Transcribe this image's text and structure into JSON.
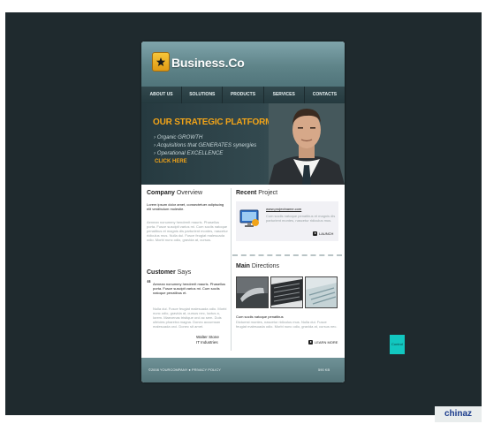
{
  "site": {
    "logo_text": "Business.Co",
    "nav": [
      "ABOUT US",
      "SOLUTIONS",
      "PRODUCTS",
      "SERVICES",
      "CONTACTS"
    ],
    "hero": {
      "title": "OUR STRATEGIC PLATFORM",
      "bullets": [
        "› Organic GROWTH",
        "› Acquisitions that GENERATES synergies",
        "› Operational EXCELLENCE"
      ],
      "cta": "CLICK HERE"
    },
    "company": {
      "title_bold": "Company",
      "title_light": "Overview",
      "intro": "Lorem ipsum dolor amet, consectetuer adipiscing elit vestibulum molestie.",
      "body": "Aenean nonummy hendrerit mauris. Phasellus porta. Fusce suscipit varius mi. Cum sociis natoque penatibus et magnis dis parturient montes, nascetur ridiculus mus. Nulla dui. Fusce feugiat malesuada odio. Morbi nunc odio, gravida at, cursus."
    },
    "customer": {
      "title_bold": "Customer",
      "title_light": "Says",
      "quote_mark": "“",
      "quote": "Aenean nonummy hendrerit mauris. Phasellus porta. Fusce suscipit varius mi. Cum sociis natoque penatibus et.",
      "body": "Nulla dui. Fusce feugiat malesuada odio. Morbi nunc odio, gravida at, cursus nec, luctus a, lorem. Maecenas tristique orci ac sem. Duis ultricies pharetra magna. Donec accumsan malesuada orci. Donec sit amet.",
      "sign_name": "Walter Stone",
      "sign_company": "IT Industries"
    },
    "recent": {
      "title_bold": "Recent",
      "title_light": "Project",
      "link": "www.projectname.com",
      "desc": "Cum sociis natoque penatibus et magnis dis parturient montes, nascetur ridiculus mus.",
      "launch": "LAUNCH"
    },
    "directions": {
      "title_bold": "Main",
      "title_light": "Directions",
      "heading": "Cum sociis natoque penatibus",
      "desc": "Dictumst montes, nascetur ridiculus mus. Nulla dui. Fusce feugiat malesuada odio. Morbi nunc odio, gravida at, cursus nec.",
      "learn_more": "LEARN MORE"
    },
    "footer": {
      "left": "©2008 YOURCOMPANY  ●  PRIVACY POLICY",
      "right": "590 KB"
    }
  },
  "control_label": "Control",
  "watermark": "chinaz",
  "colors": {
    "accent": "#f2a418",
    "header_teal": "#5f8489",
    "page_bg": "#1f2a2e",
    "control_cyan": "#12c7c0"
  }
}
